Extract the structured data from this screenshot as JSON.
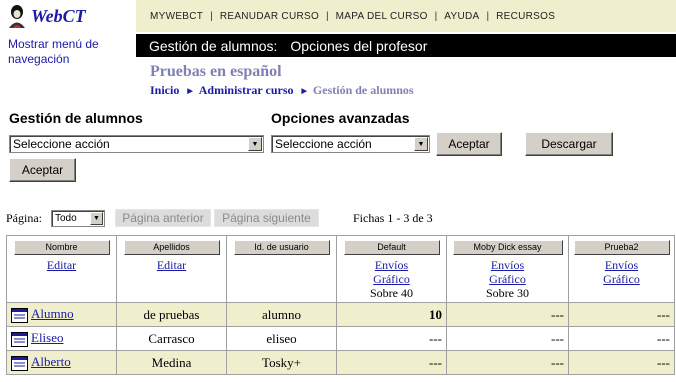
{
  "app": {
    "logo": "WebCT",
    "nav_toggle": "Mostrar menú de navegación"
  },
  "topnav": [
    "MYWEBCT",
    "REANUDAR CURSO",
    "MAPA DEL CURSO",
    "AYUDA",
    "RECURSOS"
  ],
  "titlebar": {
    "part1": "Gestión de alumnos:",
    "part2": "Opciones del profesor"
  },
  "course": {
    "name": "Pruebas en español"
  },
  "breadcrumb": [
    "Inicio",
    "Administrar curso",
    "Gestión de alumnos"
  ],
  "student_mgmt": {
    "title": "Gestión de alumnos",
    "select_value": "Seleccione acción",
    "accept": "Aceptar"
  },
  "advanced": {
    "title": "Opciones avanzadas",
    "select_value": "Seleccione acción",
    "accept": "Aceptar",
    "download": "Descargar"
  },
  "paging": {
    "label": "Página:",
    "page_value": "Todo",
    "prev": "Página anterior",
    "next": "Página siguiente",
    "records": "Fichas 1 - 3 de 3"
  },
  "table": {
    "columns": [
      {
        "header": "Nombre",
        "links": [
          "Editar"
        ],
        "note": ""
      },
      {
        "header": "Apellidos",
        "links": [
          "Editar"
        ],
        "note": ""
      },
      {
        "header": "Id. de usuario",
        "links": [],
        "note": ""
      },
      {
        "header": "Default",
        "links": [
          "Envíos",
          "Gráfico"
        ],
        "note": "Sobre 40"
      },
      {
        "header": "Moby Dick essay",
        "links": [
          "Envíos",
          "Gráfico"
        ],
        "note": "Sobre 30"
      },
      {
        "header": "Prueba2",
        "links": [
          "Envíos",
          "Gráfico"
        ],
        "note": ""
      }
    ],
    "rows": [
      {
        "first": "Alumno",
        "last": "de pruebas",
        "id": "alumno",
        "default": "10",
        "moby": "---",
        "prueba2": "---"
      },
      {
        "first": "Eliseo",
        "last": "Carrasco",
        "id": "eliseo",
        "default": "---",
        "moby": "---",
        "prueba2": "---"
      },
      {
        "first": "Alberto",
        "last": "Medina",
        "id": "Tosky+",
        "default": "---",
        "moby": "---",
        "prueba2": "---"
      }
    ]
  }
}
